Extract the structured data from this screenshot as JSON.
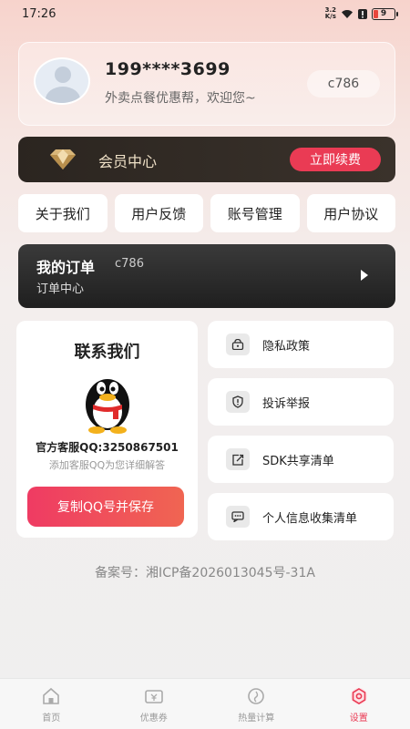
{
  "status_bar": {
    "time": "17:26",
    "net_speed_top": "3.2",
    "net_speed_bottom": "K/s",
    "battery": "9"
  },
  "profile": {
    "phone": "199****3699",
    "welcome": "外卖点餐优惠帮，欢迎您~",
    "code": "c786"
  },
  "vip": {
    "title": "会员中心",
    "renew_label": "立即续费"
  },
  "quick_links": [
    "关于我们",
    "用户反馈",
    "账号管理",
    "用户协议"
  ],
  "orders": {
    "title": "我的订单",
    "code": "c786",
    "subtitle": "订单中心"
  },
  "contact": {
    "title": "联系我们",
    "qq_line": "官方客服QQ:3250867501",
    "hint": "添加客服QQ为您详细解答",
    "copy_label": "复制QQ号并保存"
  },
  "side_menu": [
    {
      "label": "隐私政策",
      "icon": "lock-icon"
    },
    {
      "label": "投诉举报",
      "icon": "shield-alert-icon"
    },
    {
      "label": "SDK共享清单",
      "icon": "share-icon"
    },
    {
      "label": "个人信息收集清单",
      "icon": "message-icon"
    }
  ],
  "icp": "备案号：湘ICP备2026013045号-31A",
  "tabs": [
    {
      "label": "首页",
      "icon": "home-icon"
    },
    {
      "label": "优惠券",
      "icon": "coupon-icon"
    },
    {
      "label": "热量计算",
      "icon": "calorie-icon"
    },
    {
      "label": "设置",
      "icon": "settings-icon",
      "active": true
    }
  ],
  "colors": {
    "accent": "#ea3b54",
    "dark_bar": "#2b2520",
    "vip_text": "#f0e2c8"
  }
}
